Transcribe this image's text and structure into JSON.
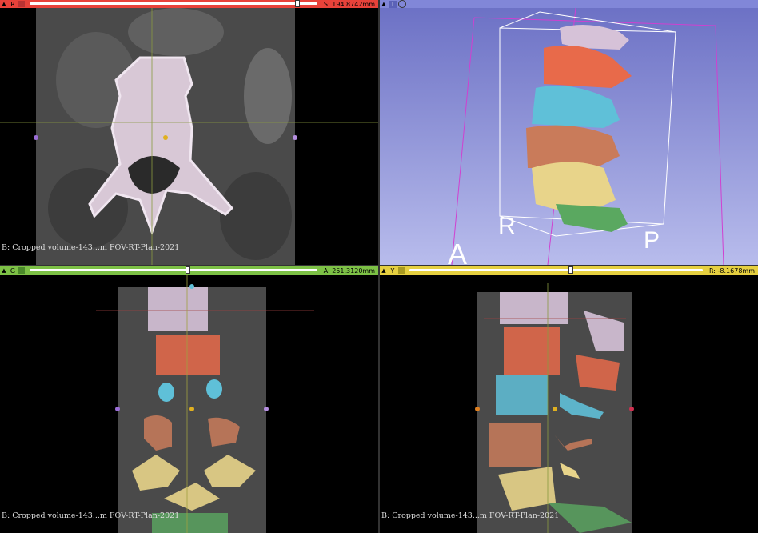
{
  "views": {
    "red": {
      "label": "R",
      "value": "S: 194.8742mm",
      "caption": "B: Cropped volume-143...m FOV-RT-Plan-2021",
      "color": "#e8423a",
      "slider": 0.93
    },
    "green": {
      "label": "G",
      "value": "A: 251.3120mm",
      "caption": "B: Cropped volume-143...m FOV-RT-Plan-2021",
      "color": "#7dc146",
      "slider": 0.55
    },
    "yellow": {
      "label": "Y",
      "value": "R: -8.1678mm",
      "caption": "B: Cropped volume-143...m FOV-RT-Plan-2021",
      "color": "#e6d040",
      "slider": 0.55
    },
    "threed": {
      "label": "1",
      "color": "#8187d8",
      "orientation_labels": [
        "R",
        "P",
        "A"
      ]
    }
  },
  "segment_colors": {
    "L1": "#d6c2d8",
    "L2": "#e86a4a",
    "L3": "#5fc0d8",
    "L4": "#c97b5a",
    "L5": "#e8d48a",
    "S1": "#5aa860"
  }
}
